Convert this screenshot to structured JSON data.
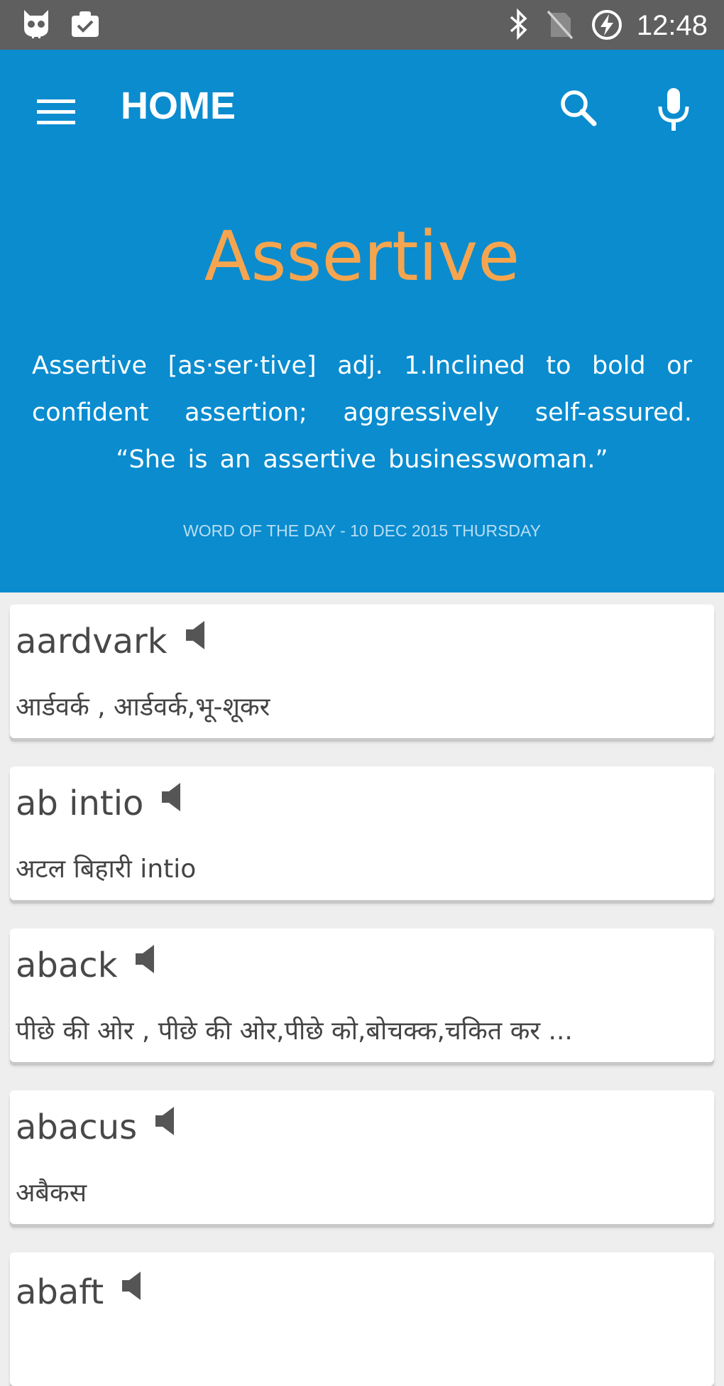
{
  "status_bar": {
    "time": "12:48",
    "icons": [
      "app-robot-icon",
      "clipboard-check-icon",
      "bluetooth-icon",
      "no-sim-icon",
      "battery-charging-icon"
    ]
  },
  "appbar": {
    "title": "HOME",
    "icons": [
      "menu-icon",
      "search-icon",
      "mic-icon"
    ],
    "background": "#0a8ccf"
  },
  "word_of_day": {
    "word": "Assertive",
    "definition": "Assertive [as·ser·tive] adj. 1.Inclined to bold or confident assertion; aggressively self-assured. “She is an assertive businesswoman.”",
    "date_label": "WORD OF THE DAY - 10 DEC 2015 THURSDAY",
    "word_color": "#f6a54f"
  },
  "entries": [
    {
      "word": "aardvark",
      "meaning": "आर्डवर्क , आर्डवर्क,भू-शूकर"
    },
    {
      "word": "ab intio",
      "meaning": "अटल बिहारी intio"
    },
    {
      "word": "aback",
      "meaning": "पीछे की ओर , पीछे की ओर,पीछे को,बोचक्क,चकित कर ..."
    },
    {
      "word": "abacus",
      "meaning": "अबैकस"
    },
    {
      "word": "abaft",
      "meaning": ""
    }
  ]
}
